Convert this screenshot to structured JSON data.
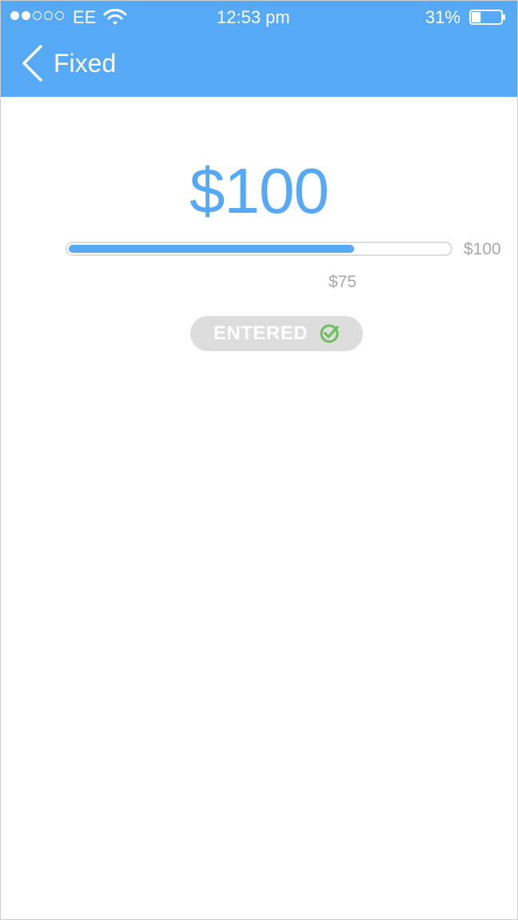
{
  "status_bar": {
    "signal_dots": [
      true,
      true,
      false,
      false,
      false
    ],
    "carrier": "EE",
    "time": "12:53 pm",
    "battery_percent": "31%",
    "battery_level": 0.31
  },
  "nav": {
    "title": "Fixed"
  },
  "amount": "$100",
  "progress": {
    "fraction": 0.75,
    "goal_label": "$100",
    "current_label": "$75"
  },
  "badge": {
    "label": "ENTERED"
  },
  "colors": {
    "accent": "#56a9f5",
    "badge_bg": "#dddddd",
    "check": "#6cbf5a"
  }
}
